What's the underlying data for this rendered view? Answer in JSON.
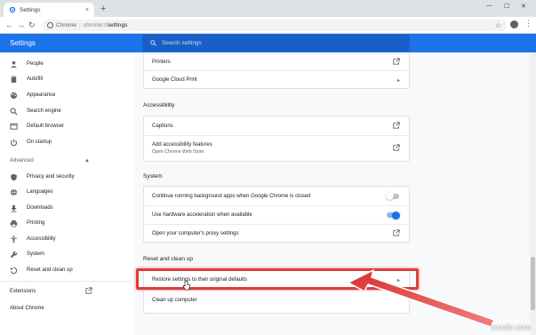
{
  "window": {
    "tab_title": "Settings",
    "tab_close": "×",
    "new_tab": "+",
    "minimize": "—",
    "maximize": "☐",
    "close": "✕"
  },
  "toolbar": {
    "back": "←",
    "forward": "→",
    "reload": "↻",
    "site_label": "Chrome",
    "separator": "|",
    "url_scheme": "chrome://",
    "url_path": "settings",
    "star": "☆",
    "menu": "⋮"
  },
  "header": {
    "title": "Settings",
    "search_placeholder": "Search settings"
  },
  "sidebar": {
    "items": [
      {
        "label": "People",
        "icon": "person-icon"
      },
      {
        "label": "Autofill",
        "icon": "clipboard-icon"
      },
      {
        "label": "Appearance",
        "icon": "palette-icon"
      },
      {
        "label": "Search engine",
        "icon": "search-icon"
      },
      {
        "label": "Default browser",
        "icon": "browser-icon"
      },
      {
        "label": "On startup",
        "icon": "power-icon"
      }
    ],
    "advanced_label": "Advanced",
    "advanced_items": [
      {
        "label": "Privacy and security",
        "icon": "shield-icon"
      },
      {
        "label": "Languages",
        "icon": "globe-icon"
      },
      {
        "label": "Downloads",
        "icon": "download-icon"
      },
      {
        "label": "Printing",
        "icon": "printer-icon"
      },
      {
        "label": "Accessibility",
        "icon": "accessibility-icon"
      },
      {
        "label": "System",
        "icon": "wrench-icon"
      },
      {
        "label": "Reset and clean up",
        "icon": "reset-icon"
      }
    ],
    "extensions_label": "Extensions",
    "about_label": "About Chrome"
  },
  "main": {
    "printing_rows": [
      {
        "label": "Printers",
        "icon": "external-link-icon"
      },
      {
        "label": "Google Cloud Print",
        "icon": "chevron-right-icon"
      }
    ],
    "accessibility": {
      "title": "Accessibility",
      "rows": [
        {
          "label": "Captions",
          "icon": "external-link-icon"
        },
        {
          "label": "Add accessibility features",
          "sub": "Open Chrome Web Store",
          "icon": "external-link-icon"
        }
      ]
    },
    "system": {
      "title": "System",
      "rows": [
        {
          "label": "Continue running background apps when Google Chrome is closed",
          "toggle": false
        },
        {
          "label": "Use hardware acceleration when available",
          "toggle": true
        },
        {
          "label": "Open your computer's proxy settings",
          "icon": "external-link-icon"
        }
      ]
    },
    "reset": {
      "title": "Reset and clean up",
      "rows": [
        {
          "label": "Restore settings to their original defaults",
          "icon": "chevron-right-icon"
        },
        {
          "label": "Clean up computer"
        }
      ]
    }
  },
  "watermark": "wsxdn.com",
  "colors": {
    "accent": "#1a73e8",
    "highlight": "#e03c3c",
    "toggle_on": "#1a73e8",
    "toggle_off": "#bdc1c6"
  }
}
